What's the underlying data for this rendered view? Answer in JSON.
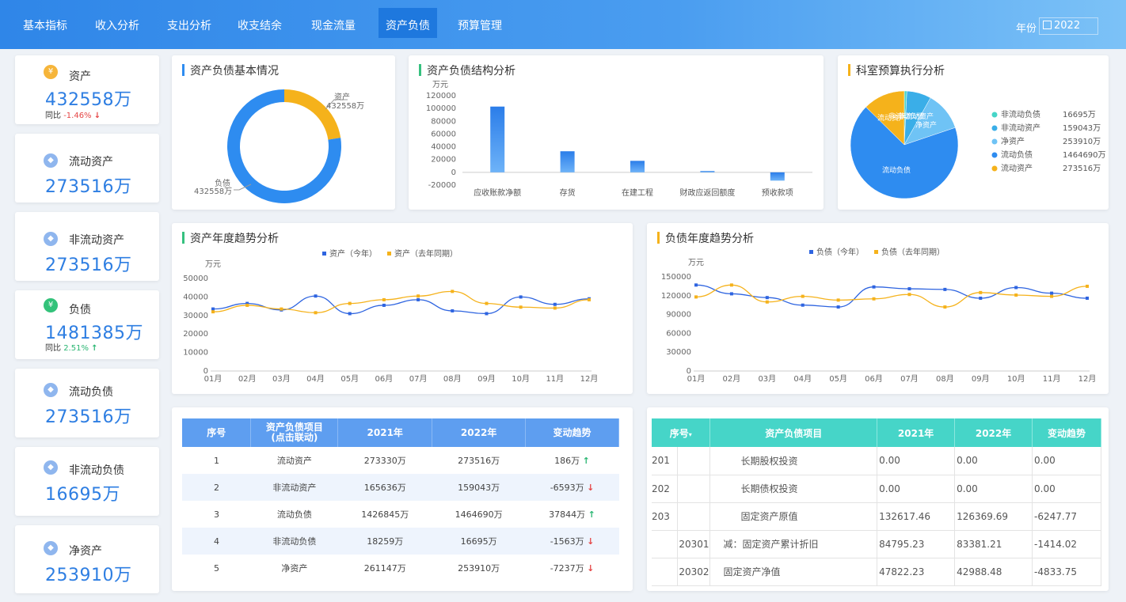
{
  "nav": {
    "tabs": [
      "基本指标",
      "收入分析",
      "支出分析",
      "收支结余",
      "现金流量",
      "资产负债",
      "预算管理"
    ],
    "active": 5,
    "year_label": "年份",
    "year_value": "2022",
    "year_icon": "calendar-icon"
  },
  "kpis": [
    {
      "label": "资产",
      "value": "432558万",
      "yoy_label": "同比",
      "yoy": "-1.46%",
      "trend": "down",
      "icon": "coin-icon",
      "icon_color": "#f6b53a"
    },
    {
      "label": "流动资产",
      "value": "273516万",
      "icon": "cube-icon",
      "icon_color": "#8fb6ee"
    },
    {
      "label": "非流动资产",
      "value": "273516万",
      "icon": "cube-icon",
      "icon_color": "#8fb6ee"
    },
    {
      "label": "负债",
      "value": "1481385万",
      "yoy_label": "同比",
      "yoy": "2.51%",
      "trend": "up",
      "icon": "coin-icon",
      "icon_color": "#33c27a"
    },
    {
      "label": "流动负债",
      "value": "273516万",
      "icon": "cube-icon",
      "icon_color": "#8fb6ee"
    },
    {
      "label": "非流动负债",
      "value": "16695万",
      "icon": "cube-icon",
      "icon_color": "#8fb6ee"
    },
    {
      "label": "净资产",
      "value": "253910万",
      "icon": "cube-icon",
      "icon_color": "#8fb6ee"
    }
  ],
  "panels": {
    "basic_title": "资产负债基本情况",
    "structure_title": "资产负债结构分析",
    "budget_title": "科室预算执行分析",
    "asset_trend_title": "资产年度趋势分析",
    "debt_trend_title": "负债年度趋势分析"
  },
  "colors": {
    "blue": "#2e8cf0",
    "orange": "#f5b21b",
    "green": "#36c17f",
    "teal": "#46d5c8",
    "accent": "#2e7ee2"
  },
  "chart_data": [
    {
      "type": "pie",
      "title": "资产负债基本情况",
      "slices": [
        {
          "name": "资产",
          "value": 432558
        },
        {
          "name": "负债",
          "value": 1481385
        }
      ],
      "labels": [
        {
          "name": "资产",
          "text": "432558万"
        },
        {
          "name": "负债",
          "text": "432558万"
        }
      ],
      "colors": [
        "#f5b21b",
        "#2e8cf0"
      ]
    },
    {
      "type": "bar",
      "title": "资产负债结构分析",
      "ylabel": "万元",
      "categories": [
        "应收账款净额",
        "存货",
        "在建工程",
        "财政应返回额度",
        "预收款项"
      ],
      "values": [
        103000,
        33000,
        18000,
        2000,
        -13000
      ],
      "ylim": [
        -20000,
        120000
      ],
      "yticks": [
        -20000,
        0,
        20000,
        40000,
        60000,
        80000,
        100000,
        120000
      ]
    },
    {
      "type": "pie",
      "title": "科室预算执行分析",
      "slices": [
        {
          "name": "非流动负债",
          "value": 16695,
          "text": "16695万",
          "color": "#46d5c8"
        },
        {
          "name": "非流动资产",
          "value": 159043,
          "text": "159043万",
          "color": "#3aaee8"
        },
        {
          "name": "净资产",
          "value": 253910,
          "text": "253910万",
          "color": "#6fc3f5"
        },
        {
          "name": "流动负债",
          "value": 1464690,
          "text": "1464690万",
          "color": "#2e8cf0"
        },
        {
          "name": "流动资产",
          "value": 273516,
          "text": "273516万",
          "color": "#f5b21b"
        }
      ],
      "inside_labels": [
        "流动资产",
        "非流动负债",
        "非流动资产",
        "净资产",
        "流动负债"
      ]
    },
    {
      "type": "line",
      "title": "资产年度趋势分析",
      "ylabel": "万元",
      "categories": [
        "01月",
        "02月",
        "03月",
        "04月",
        "05月",
        "06月",
        "07月",
        "08月",
        "09月",
        "10月",
        "11月",
        "12月"
      ],
      "ylim": [
        0,
        50000
      ],
      "yticks": [
        0,
        10000,
        20000,
        30000,
        40000,
        50000
      ],
      "series": [
        {
          "name": "资产（今年）",
          "color": "#2e64e0",
          "values": [
            33500,
            36500,
            33000,
            40500,
            31000,
            35500,
            38500,
            32500,
            31000,
            40000,
            36000,
            39000
          ]
        },
        {
          "name": "资产（去年同期）",
          "color": "#f5b21b",
          "values": [
            32000,
            35500,
            33500,
            31500,
            36500,
            38500,
            40500,
            43000,
            36500,
            34500,
            34000,
            38500
          ]
        }
      ]
    },
    {
      "type": "line",
      "title": "负债年度趋势分析",
      "ylabel": "万元",
      "categories": [
        "01月",
        "02月",
        "03月",
        "04月",
        "05月",
        "06月",
        "07月",
        "08月",
        "09月",
        "10月",
        "11月",
        "12月"
      ],
      "ylim": [
        0,
        150000
      ],
      "yticks": [
        0,
        30000,
        60000,
        90000,
        120000,
        150000
      ],
      "series": [
        {
          "name": "负债（今年）",
          "color": "#2e64e0",
          "values": [
            137000,
            123000,
            117000,
            105000,
            102000,
            134000,
            131000,
            130000,
            116000,
            133000,
            124000,
            116000
          ]
        },
        {
          "name": "负债（去年同期）",
          "color": "#f5b21b",
          "values": [
            118000,
            137000,
            110000,
            119000,
            113000,
            115000,
            122000,
            102000,
            125000,
            121000,
            119000,
            135000
          ]
        }
      ]
    }
  ],
  "table_main": {
    "headers": [
      "序号",
      "资产负债项目\n(点击联动)",
      "2021年",
      "2022年",
      "变动趋势"
    ],
    "rows": [
      {
        "no": "1",
        "item": "流动资产",
        "y2021": "273330万",
        "y2022": "273516万",
        "change": "186万",
        "trend": "up"
      },
      {
        "no": "2",
        "item": "非流动资产",
        "y2021": "165636万",
        "y2022": "159043万",
        "change": "-6593万",
        "trend": "down"
      },
      {
        "no": "3",
        "item": "流动负债",
        "y2021": "1426845万",
        "y2022": "1464690万",
        "change": "37844万",
        "trend": "up"
      },
      {
        "no": "4",
        "item": "非流动负债",
        "y2021": "18259万",
        "y2022": "16695万",
        "change": "-1563万",
        "trend": "down"
      },
      {
        "no": "5",
        "item": "净资产",
        "y2021": "261147万",
        "y2022": "253910万",
        "change": "-7237万",
        "trend": "down"
      }
    ]
  },
  "table_detail": {
    "headers": [
      "序号",
      "资产负债项目",
      "2021年",
      "2022年",
      "变动趋势"
    ],
    "rows": [
      {
        "code": "201",
        "sub": "",
        "item": "长期股权投资",
        "y2021": "0.00",
        "y2022": "0.00",
        "change": "0.00"
      },
      {
        "code": "202",
        "sub": "",
        "item": "长期债权投资",
        "y2021": "0.00",
        "y2022": "0.00",
        "change": "0.00"
      },
      {
        "code": "203",
        "sub": "",
        "item": "固定资产原值",
        "y2021": "132617.46",
        "y2022": "126369.69",
        "change": "-6247.77"
      },
      {
        "code": "",
        "sub": "20301",
        "item": "减：固定资产累计折旧",
        "y2021": "84795.23",
        "y2022": "83381.21",
        "change": "-1414.02"
      },
      {
        "code": "",
        "sub": "20302",
        "item": "固定资产净值",
        "y2021": "47822.23",
        "y2022": "42988.48",
        "change": "-4833.75"
      }
    ]
  }
}
